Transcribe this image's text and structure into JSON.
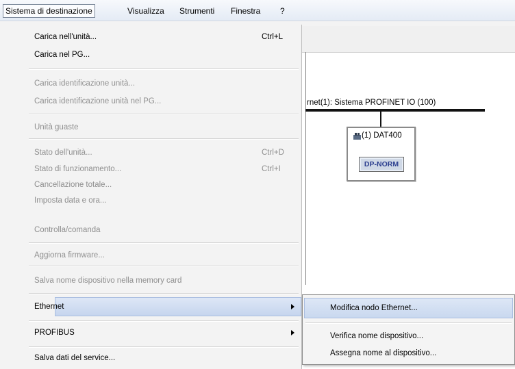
{
  "menubar": {
    "items": [
      {
        "label": "Sistema di destinazione"
      },
      {
        "label": "Visualizza"
      },
      {
        "label": "Strumenti"
      },
      {
        "label": "Finestra"
      },
      {
        "label": "?"
      }
    ]
  },
  "menu": {
    "carica_unita": {
      "label": "Carica nell'unità...",
      "shortcut": "Ctrl+L"
    },
    "carica_pg": {
      "label": "Carica nel PG..."
    },
    "carica_ident_unita": {
      "label": "Carica identificazione unità..."
    },
    "carica_ident_pg": {
      "label": "Carica identificazione unità nel PG..."
    },
    "unita_guaste": {
      "label": "Unità guaste"
    },
    "stato_unita": {
      "label": "Stato dell'unità...",
      "shortcut": "Ctrl+D"
    },
    "stato_funz": {
      "label": "Stato di funzionamento...",
      "shortcut": "Ctrl+I"
    },
    "cancellazione": {
      "label": "Cancellazione totale..."
    },
    "imposta_data": {
      "label": "Imposta data e ora..."
    },
    "controlla": {
      "label": "Controlla/comanda"
    },
    "aggiorna_fw": {
      "label": "Aggiorna firmware..."
    },
    "salva_nome": {
      "label": "Salva nome dispositivo nella memory card"
    },
    "ethernet": {
      "label": "Ethernet"
    },
    "profibus": {
      "label": "PROFIBUS"
    },
    "salva_service": {
      "label": "Salva dati del service..."
    }
  },
  "submenu": {
    "modifica_nodo": {
      "label": "Modifica nodo Ethernet..."
    },
    "verifica_nome": {
      "label": "Verifica nome dispositivo..."
    },
    "assegna_nome": {
      "label": "Assegna nome al dispositivo..."
    }
  },
  "workspace": {
    "bus_label": "rnet(1): Sistema PROFINET IO (100)",
    "device_name": "(1) DAT400",
    "device_badge": "DP-NORM"
  },
  "colors": {
    "highlight": "#c6d5ee",
    "disabled_text": "#8f8f8f",
    "badge_text": "#2b3e8f"
  }
}
